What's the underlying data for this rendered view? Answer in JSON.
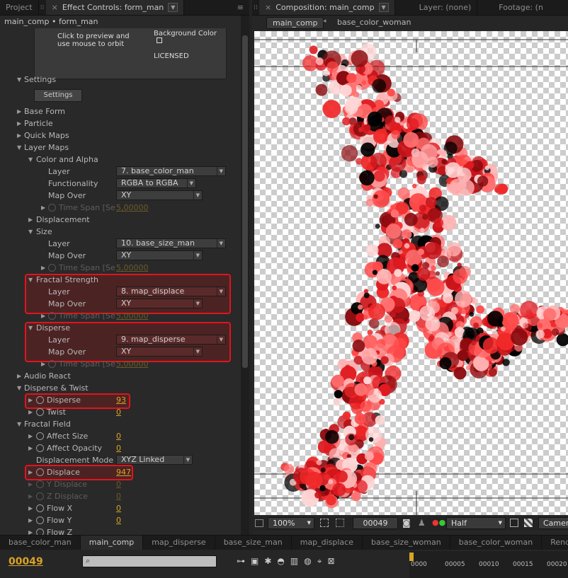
{
  "left_tabs": {
    "project": "Project",
    "effect_controls": "Effect Controls: form_man"
  },
  "breadcrumb": "main_comp • form_man",
  "preview": {
    "hint_line1": "Click to preview and",
    "hint_line2": "use mouse to orbit",
    "bg_color_label": "Background Color",
    "licensed": "LICENSED"
  },
  "settings": {
    "section": "Settings",
    "button": "Settings"
  },
  "groups": {
    "base_form": "Base Form",
    "particle": "Particle",
    "quick_maps": "Quick Maps",
    "layer_maps": "Layer Maps",
    "color_alpha": "Color and Alpha",
    "displacement": "Displacement",
    "size": "Size",
    "fractal_strength": "Fractal Strength",
    "disperse_grp": "Disperse",
    "audio_react": "Audio React",
    "disperse_twist": "Disperse & Twist",
    "fractal_field": "Fractal Field"
  },
  "labels": {
    "layer": "Layer",
    "functionality": "Functionality",
    "map_over": "Map Over",
    "time_span": "Time Span [Se",
    "disperse": "Disperse",
    "twist": "Twist",
    "affect_size": "Affect Size",
    "affect_opacity": "Affect Opacity",
    "displacement_mode": "Displacement Mode",
    "displace": "Displace",
    "y_displace": "Y Displace",
    "z_displace": "Z Displace",
    "flow_x": "Flow X",
    "flow_y": "Flow Y",
    "flow_z": "Flow Z"
  },
  "values": {
    "color_layer": "7. base_color_man",
    "functionality": "RGBA to RGBA",
    "color_map_over": "XY",
    "time_span_1": "5,00000",
    "size_layer": "10. base_size_man",
    "size_map_over": "XY",
    "time_span_2": "5,00000",
    "fractal_layer": "8. map_displace",
    "fractal_map_over": "XY",
    "time_span_3": "5,00000",
    "disperse_layer": "9. map_disperse",
    "disperse_map_over": "XY",
    "time_span_4": "5,00000",
    "disperse": "93",
    "twist": "0",
    "affect_size": "0",
    "affect_opacity": "0",
    "displacement_mode": "XYZ Linked",
    "displace": "947",
    "y_displace": "0",
    "z_displace": "0",
    "flow_x": "0",
    "flow_y": "0"
  },
  "comp_tabs": {
    "composition": "Composition: main_comp",
    "layer": "Layer: (none)",
    "footage": "Footage: (n"
  },
  "comp_nav": {
    "current": "main_comp",
    "child": "base_color_woman"
  },
  "viewer_bar": {
    "zoom": "100%",
    "timecode": "00049",
    "resolution": "Half",
    "camera": "Camer"
  },
  "timeline": {
    "tabs": [
      "base_color_man",
      "main_comp",
      "map_disperse",
      "base_size_man",
      "map_displace",
      "base_size_woman",
      "base_color_woman",
      "Render"
    ],
    "active_tab": 1,
    "timecode": "00049",
    "ruler": [
      "0000",
      "00005",
      "00010",
      "00015",
      "00020"
    ]
  },
  "colors": {
    "accent_value": "#d9a324",
    "highlight": "#e0141e",
    "particle": "#e01a20"
  }
}
